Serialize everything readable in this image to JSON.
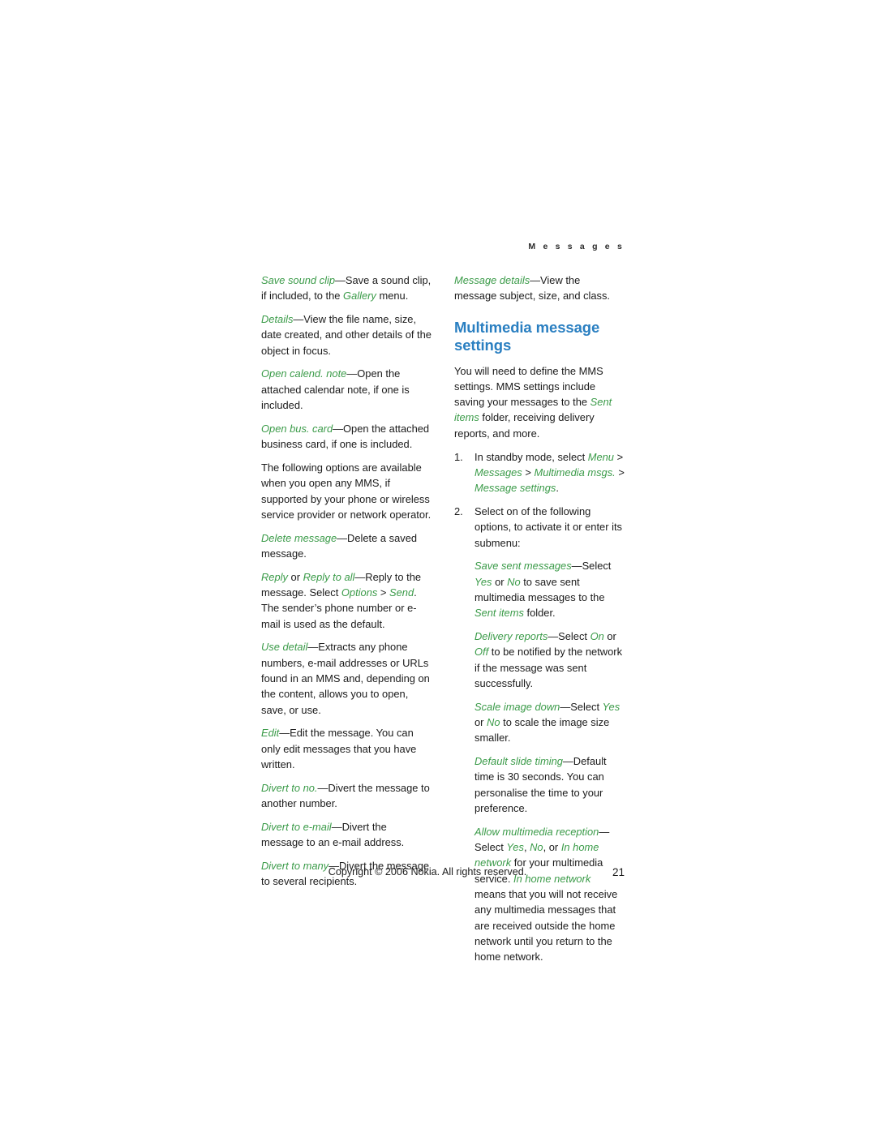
{
  "header": {
    "running_head": "M e s s a g e s"
  },
  "left_column": {
    "paragraphs": [
      [
        {
          "t": "Save sound clip",
          "s": "i"
        },
        {
          "t": "—Save a sound clip, if included, to the ",
          "s": "n"
        },
        {
          "t": "Gallery",
          "s": "i"
        },
        {
          "t": " menu.",
          "s": "n"
        }
      ],
      [
        {
          "t": "Details",
          "s": "i"
        },
        {
          "t": "—View the file name, size, date created, and other details of the object in focus.",
          "s": "n"
        }
      ],
      [
        {
          "t": "Open calend. note",
          "s": "i"
        },
        {
          "t": "—Open the attached calendar note, if one is included.",
          "s": "n"
        }
      ],
      [
        {
          "t": "Open bus. card",
          "s": "i"
        },
        {
          "t": "—Open the attached business card, if one is included.",
          "s": "n"
        }
      ],
      [
        {
          "t": "The following options are available when you open any MMS, if supported by your phone or wireless service provider or network operator.",
          "s": "n"
        }
      ],
      [
        {
          "t": "Delete message",
          "s": "i"
        },
        {
          "t": "—Delete a saved message.",
          "s": "n"
        }
      ],
      [
        {
          "t": "Reply",
          "s": "i"
        },
        {
          "t": " or ",
          "s": "n"
        },
        {
          "t": "Reply to all",
          "s": "i"
        },
        {
          "t": "—Reply to the message. Select ",
          "s": "n"
        },
        {
          "t": "Options",
          "s": "i"
        },
        {
          "t": " > ",
          "s": "n"
        },
        {
          "t": "Send",
          "s": "i"
        },
        {
          "t": ". The sender’s phone number or e-mail is used as the default.",
          "s": "n"
        }
      ],
      [
        {
          "t": "Use detail",
          "s": "i"
        },
        {
          "t": "—Extracts any phone numbers, e-mail addresses or URLs found in an MMS and, depending on the content, allows you to open, save, or use.",
          "s": "n"
        }
      ],
      [
        {
          "t": "Edit",
          "s": "i"
        },
        {
          "t": "—Edit the message. You can only edit messages that you have written.",
          "s": "n"
        }
      ],
      [
        {
          "t": "Divert to no.",
          "s": "i"
        },
        {
          "t": "—Divert the message to another number.",
          "s": "n"
        }
      ],
      [
        {
          "t": "Divert to e-mail",
          "s": "i"
        },
        {
          "t": "—Divert the message to an e-mail address.",
          "s": "n"
        }
      ],
      [
        {
          "t": "Divert to many",
          "s": "i"
        },
        {
          "t": "—Divert the message to several recipients.",
          "s": "n"
        }
      ]
    ]
  },
  "right_column": {
    "intro_paragraph": [
      {
        "t": "Message details",
        "s": "i"
      },
      {
        "t": "—View the message subject, size, and class.",
        "s": "n"
      }
    ],
    "section_title": "Multimedia message settings",
    "body_paragraph": [
      {
        "t": "You will need to define the MMS settings. MMS settings include saving your messages to the ",
        "s": "n"
      },
      {
        "t": "Sent items",
        "s": "i"
      },
      {
        "t": " folder, receiving delivery reports, and more.",
        "s": "n"
      }
    ],
    "steps": [
      {
        "num": "1.",
        "parts": [
          {
            "t": "In standby mode, select ",
            "s": "n"
          },
          {
            "t": "Menu",
            "s": "i"
          },
          {
            "t": " > ",
            "s": "n"
          },
          {
            "t": "Messages",
            "s": "i"
          },
          {
            "t": " > ",
            "s": "n"
          },
          {
            "t": "Multimedia msgs.",
            "s": "i"
          },
          {
            "t": " > ",
            "s": "n"
          },
          {
            "t": "Message settings",
            "s": "i"
          },
          {
            "t": ".",
            "s": "n"
          }
        ]
      },
      {
        "num": "2.",
        "parts": [
          {
            "t": "Select on of the following options, to activate it or enter its submenu:",
            "s": "n"
          }
        ]
      }
    ],
    "sub_paragraphs": [
      [
        {
          "t": "Save sent messages",
          "s": "i"
        },
        {
          "t": "—Select ",
          "s": "n"
        },
        {
          "t": "Yes",
          "s": "i"
        },
        {
          "t": " or ",
          "s": "n"
        },
        {
          "t": "No",
          "s": "i"
        },
        {
          "t": " to save sent multimedia messages to the ",
          "s": "n"
        },
        {
          "t": "Sent items",
          "s": "i"
        },
        {
          "t": " folder.",
          "s": "n"
        }
      ],
      [
        {
          "t": "Delivery reports",
          "s": "i"
        },
        {
          "t": "—Select ",
          "s": "n"
        },
        {
          "t": "On",
          "s": "i"
        },
        {
          "t": " or ",
          "s": "n"
        },
        {
          "t": "Off",
          "s": "i"
        },
        {
          "t": " to be notified by the network if the message was sent successfully.",
          "s": "n"
        }
      ],
      [
        {
          "t": "Scale image down",
          "s": "i"
        },
        {
          "t": "—Select ",
          "s": "n"
        },
        {
          "t": "Yes",
          "s": "i"
        },
        {
          "t": " or ",
          "s": "n"
        },
        {
          "t": "No",
          "s": "i"
        },
        {
          "t": " to scale the image size smaller.",
          "s": "n"
        }
      ],
      [
        {
          "t": "Default slide timing",
          "s": "i"
        },
        {
          "t": "—Default time is 30 seconds. You can personalise the time to your preference.",
          "s": "n"
        }
      ],
      [
        {
          "t": "Allow multimedia reception",
          "s": "i"
        },
        {
          "t": "—Select ",
          "s": "n"
        },
        {
          "t": "Yes",
          "s": "i"
        },
        {
          "t": ", ",
          "s": "n"
        },
        {
          "t": "No",
          "s": "i"
        },
        {
          "t": ", or ",
          "s": "n"
        },
        {
          "t": "In home network",
          "s": "i"
        },
        {
          "t": " for your multimedia service. ",
          "s": "n"
        },
        {
          "t": "In home network",
          "s": "i"
        },
        {
          "t": " means that you will not receive any multimedia messages that are received outside the home network until you return to the home network.",
          "s": "n"
        }
      ]
    ]
  },
  "footer": {
    "copyright": "Copyright © 2006 Nokia. All rights reserved.",
    "page_number": "21"
  }
}
